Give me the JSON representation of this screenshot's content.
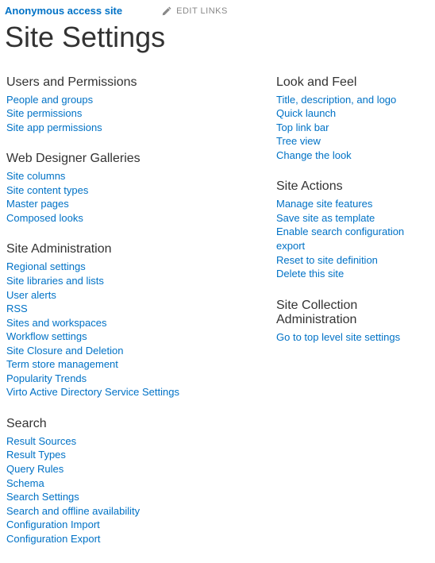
{
  "breadcrumb": "Anonymous access site",
  "edit_links_label": "EDIT LINKS",
  "page_title": "Site Settings",
  "left_sections": [
    {
      "heading": "Users and Permissions",
      "links": [
        "People and groups",
        "Site permissions",
        "Site app permissions"
      ]
    },
    {
      "heading": "Web Designer Galleries",
      "links": [
        "Site columns",
        "Site content types",
        "Master pages",
        "Composed looks"
      ]
    },
    {
      "heading": "Site Administration",
      "links": [
        "Regional settings",
        "Site libraries and lists",
        "User alerts",
        "RSS",
        "Sites and workspaces",
        "Workflow settings",
        "Site Closure and Deletion",
        "Term store management",
        "Popularity Trends",
        "Virto Active Directory Service Settings"
      ]
    },
    {
      "heading": "Search",
      "links": [
        "Result Sources",
        "Result Types",
        "Query Rules",
        "Schema",
        "Search Settings",
        "Search and offline availability",
        "Configuration Import",
        "Configuration Export"
      ]
    }
  ],
  "right_sections": [
    {
      "heading": "Look and Feel",
      "links": [
        "Title, description, and logo",
        "Quick launch",
        "Top link bar",
        "Tree view",
        "Change the look"
      ]
    },
    {
      "heading": "Site Actions",
      "links": [
        "Manage site features",
        "Save site as template",
        "Enable search configuration export",
        "Reset to site definition",
        "Delete this site"
      ]
    },
    {
      "heading": "Site Collection Administration",
      "links": [
        "Go to top level site settings"
      ]
    }
  ]
}
